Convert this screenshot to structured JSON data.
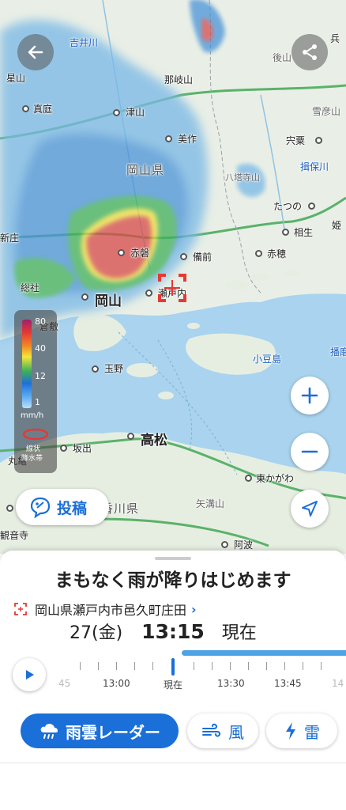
{
  "map": {
    "places": {
      "yoshii_river": "吉井川",
      "hoshi": "星山",
      "maniwa": "真庭",
      "tsuyama": "津山",
      "nagi": "那岐山",
      "mimasaka": "美作",
      "okayama_pref": "岡山県",
      "akaiwa": "赤磐",
      "bizen": "備前",
      "okayama": "岡山",
      "setouchi": "瀬戸内",
      "soja": "総社",
      "kurashiki": "倉敷",
      "tamano": "玉野",
      "shodoshima": "小豆島",
      "takamatsu": "高松",
      "sakaide": "坂出",
      "marugame": "丸亀",
      "kagawa_pref": "香川県",
      "higashikagawa": "東かがわ",
      "yasakuyama": "矢溝山",
      "awa": "阿波",
      "kanonji": "観音寺",
      "shiso": "宍粟",
      "ibo_river": "揖保川",
      "tatsuno": "たつの",
      "aioi": "相生",
      "ako": "赤穂",
      "goshiyama": "後山",
      "setsuhiko": "雪彦山",
      "hyo": "兵",
      "hime": "姫",
      "harima": "播磨",
      "hatogami": "八塔寺山",
      "shinjo": "新庄"
    },
    "legend": {
      "labels": [
        "80",
        "40",
        "12",
        "1"
      ],
      "unit": "mm/h",
      "band_label_1": "線状",
      "band_label_2": "降水帯"
    },
    "post_button": "投稿",
    "colors": {
      "accent": "#1a6fd8",
      "heavy_rain": "#d84a4a",
      "moderate_rain": "#f0e040"
    }
  },
  "sheet": {
    "headline": "まもなく雨が降りはじめます",
    "location": "岡山県瀬戸内市邑久町庄田",
    "date": "27(金)",
    "time": "13:15",
    "now_label": "現在",
    "timeline": [
      "45",
      "13:00",
      "現在",
      "13:30",
      "13:45",
      "14"
    ]
  },
  "tabs": {
    "rain_radar": "雨雲レーダー",
    "wind": "風",
    "thunder": "雷"
  }
}
